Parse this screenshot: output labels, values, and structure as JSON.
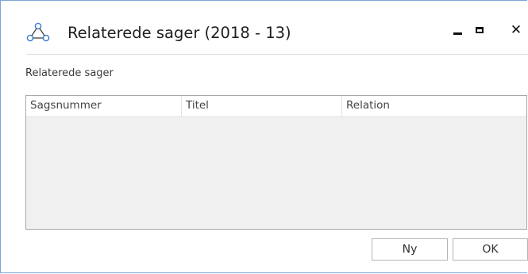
{
  "window": {
    "title": "Relaterede sager (2018 - 13)",
    "icon": "related-cases-icon",
    "controls": {
      "minimize": "minimize-icon",
      "maximize": "maximize-icon",
      "close": "close-icon"
    }
  },
  "section": {
    "label": "Relaterede sager"
  },
  "table": {
    "columns": [
      "Sagsnummer",
      "Titel",
      "Relation"
    ],
    "rows": []
  },
  "buttons": {
    "new_label": "Ny",
    "ok_label": "OK"
  },
  "colors": {
    "window_border": "#7aa7d6",
    "grid_background": "#f0f0f0",
    "icon_accent": "#3a7bd5"
  }
}
